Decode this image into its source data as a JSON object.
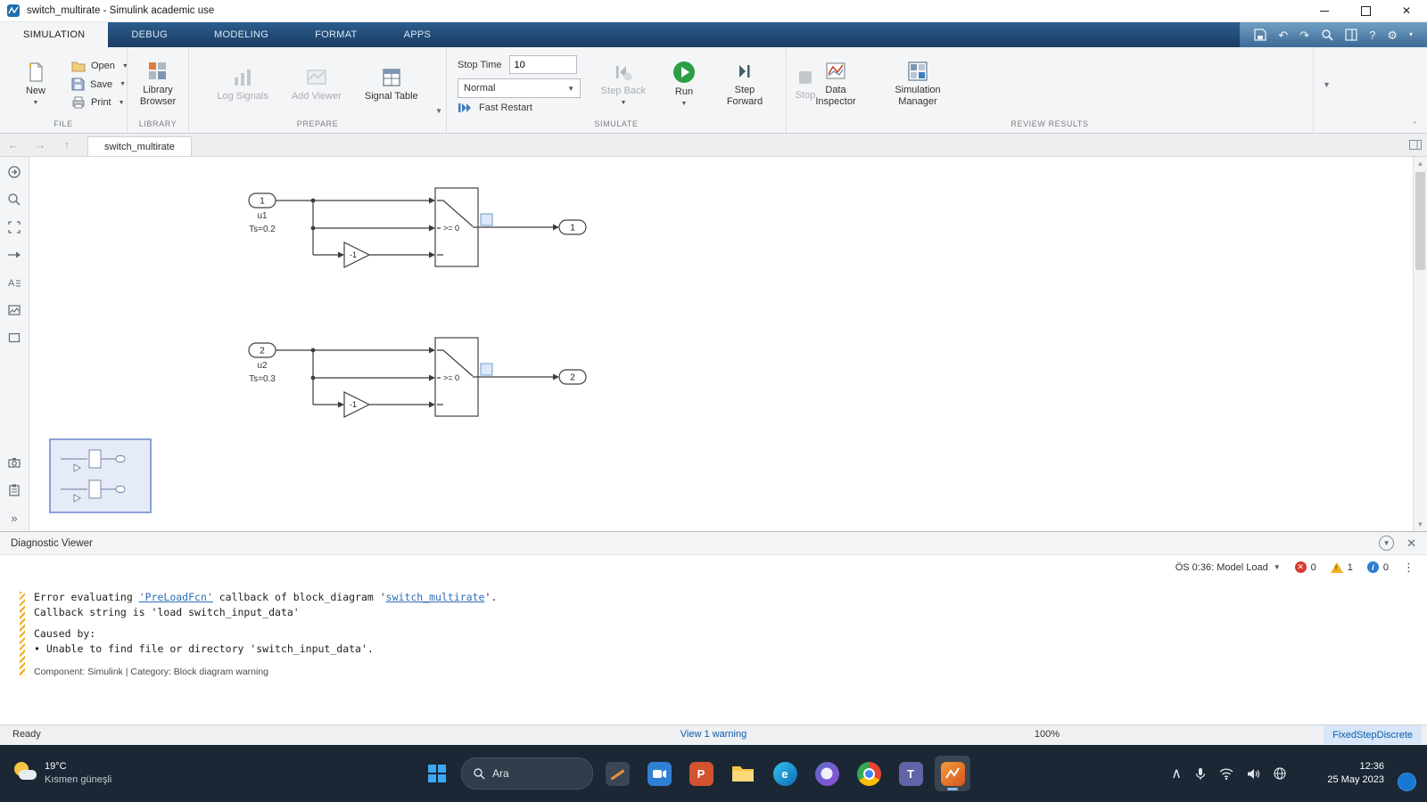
{
  "titlebar": {
    "title": "switch_multirate - Simulink academic use"
  },
  "tabs": {
    "simulation": "SIMULATION",
    "debug": "DEBUG",
    "modeling": "MODELING",
    "format": "FORMAT",
    "apps": "APPS"
  },
  "toolbar": {
    "file": {
      "section": "FILE",
      "new": "New",
      "open": "Open",
      "save": "Save",
      "print": "Print"
    },
    "library": {
      "section": "LIBRARY",
      "browser": "Library Browser"
    },
    "prepare": {
      "section": "PREPARE",
      "log_signals": "Log Signals",
      "add_viewer": "Add Viewer",
      "signal_table": "Signal Table"
    },
    "simulate": {
      "section": "SIMULATE",
      "stop_time_label": "Stop Time",
      "stop_time_value": "10",
      "mode": "Normal",
      "fast_restart": "Fast Restart",
      "step_back": "Step Back",
      "run": "Run",
      "step_forward": "Step Forward",
      "stop": "Stop"
    },
    "review": {
      "section": "REVIEW RESULTS",
      "data_inspector": "Data Inspector",
      "simulation_manager": "Simulation Manager"
    }
  },
  "docbar": {
    "tab": "switch_multirate"
  },
  "diagram": {
    "systems": [
      {
        "inport": "1",
        "name": "u1",
        "ts": "Ts=0.2",
        "gain": "-1",
        "threshold": ">= 0",
        "outport": "1"
      },
      {
        "inport": "2",
        "name": "u2",
        "ts": "Ts=0.3",
        "gain": "-1",
        "threshold": ">= 0",
        "outport": "2"
      }
    ]
  },
  "diagnostic": {
    "title": "Diagnostic Viewer",
    "stage": "ÖS 0:36: Model Load",
    "error_count": "0",
    "warning_count": "1",
    "info_count": "0",
    "message": {
      "l1a": "Error evaluating ",
      "l1_link1": "'PreLoadFcn'",
      "l1b": " callback of block_diagram '",
      "l1_link2": "switch_multirate",
      "l1c": "'.",
      "l2": "Callback string is 'load switch_input_data'",
      "caused": "Caused by:",
      "bullet": "Unable to find file or directory 'switch_input_data'.",
      "footer": "Component: Simulink | Category: Block diagram warning"
    }
  },
  "statusbar": {
    "ready": "Ready",
    "warning": "View 1 warning",
    "zoom": "100%",
    "solver": "FixedStepDiscrete"
  },
  "taskbar": {
    "weather_temp": "19°C",
    "weather_desc": "Kısmen güneşli",
    "search": "Ara",
    "time": "12:36",
    "date": "25 May 2023"
  }
}
